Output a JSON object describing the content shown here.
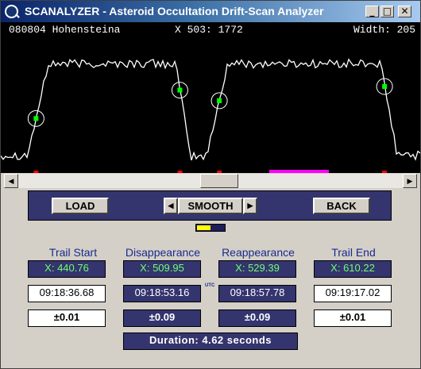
{
  "window": {
    "title": "SCANALYZER - Asteroid Occultation Drift-Scan Analyzer"
  },
  "title_buttons": {
    "minimize": "_",
    "maximize": "□",
    "close": "✕"
  },
  "header": {
    "station": "080804 Hohensteina",
    "cursor": "X 503: 1772",
    "width": "Width: 205"
  },
  "trace": {
    "color": "#ffffff",
    "marker_color": "#00ff00",
    "top_level": 0.83,
    "bottom_level": 0.11,
    "dip_level": 0.1,
    "events": [
      {
        "name": "trail-start",
        "position": 0.084
      },
      {
        "name": "disappearance",
        "position": 0.427
      },
      {
        "name": "reappearance",
        "position": 0.521
      },
      {
        "name": "trail-end",
        "position": 0.915
      }
    ],
    "tick_color": "#ff0000",
    "highlight_color": "#ff00ff"
  },
  "controls": {
    "load": "LOAD",
    "smooth": "SMOOTH",
    "back": "BACK",
    "left_arrow": "◀",
    "right_arrow": "▶",
    "smooth_level": 0.5
  },
  "scrollbar": {
    "left_arrow": "◀",
    "right_arrow": "▶"
  },
  "results": {
    "trail_start": {
      "label": "Trail Start",
      "x": "X:  440.76",
      "time": "09:18:36.68",
      "err": "±0.01"
    },
    "disappearance": {
      "label": "Disappearance",
      "x": "X:  509.95",
      "time": "09:18:53.16",
      "err": "±0.09"
    },
    "reappearance": {
      "label": "Reappearance",
      "x": "X:  529.39",
      "time": "09:18:57.78",
      "err": "±0.09"
    },
    "trail_end": {
      "label": "Trail End",
      "x": "X:  610.22",
      "time": "09:19:17.02",
      "err": "±0.01"
    },
    "utc_label": "UTC",
    "duration": "Duration:  4.62  seconds"
  }
}
